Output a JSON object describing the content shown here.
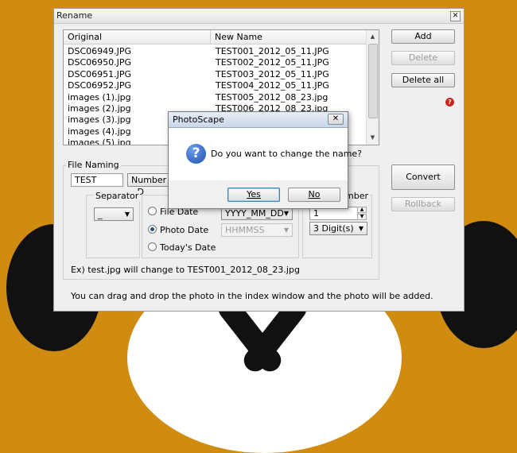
{
  "window": {
    "title": "Rename"
  },
  "list": {
    "headers": [
      "Original",
      "New Name"
    ],
    "rows": [
      [
        "DSC06949.JPG",
        "TEST001_2012_05_11.JPG"
      ],
      [
        "DSC06950.JPG",
        "TEST002_2012_05_11.JPG"
      ],
      [
        "DSC06951.JPG",
        "TEST003_2012_05_11.JPG"
      ],
      [
        "DSC06952.JPG",
        "TEST004_2012_05_11.JPG"
      ],
      [
        "images (1).jpg",
        "TEST005_2012_08_23.jpg"
      ],
      [
        "images (2).jpg",
        "TEST006_2012_08_23.jpg"
      ],
      [
        "images (3).jpg",
        ""
      ],
      [
        "images (4).jpg",
        ""
      ],
      [
        "images (5).jpg",
        ""
      ]
    ]
  },
  "buttons": {
    "add": "Add",
    "delete": "Delete",
    "delete_all": "Delete all",
    "convert": "Convert",
    "rollback": "Rollback"
  },
  "file_naming": {
    "label": "File Naming",
    "name_value": "TEST",
    "mode_combo": "Number - D",
    "separator_label": "Separator",
    "separator_value": "_",
    "date_options": [
      "File Date",
      "Photo Date",
      "Today's Date"
    ],
    "date_selected": "Photo Date",
    "date_format": "YYYY_MM_DD",
    "time_format": "HHMMSS",
    "number_label": "mber",
    "number_start": "1",
    "digits_value": "3 Digit(s)",
    "example": "Ex) test.jpg will change to TEST001_2012_08_23.jpg"
  },
  "hint": "You can drag and drop the photo in the index window and the photo will be added.",
  "dialog": {
    "title": "PhotoScape",
    "message": "Do you want to change the name?",
    "yes": "Yes",
    "no": "No"
  },
  "colors": {
    "background": "#d08c10",
    "selection_dot": "#2a4f8a"
  }
}
